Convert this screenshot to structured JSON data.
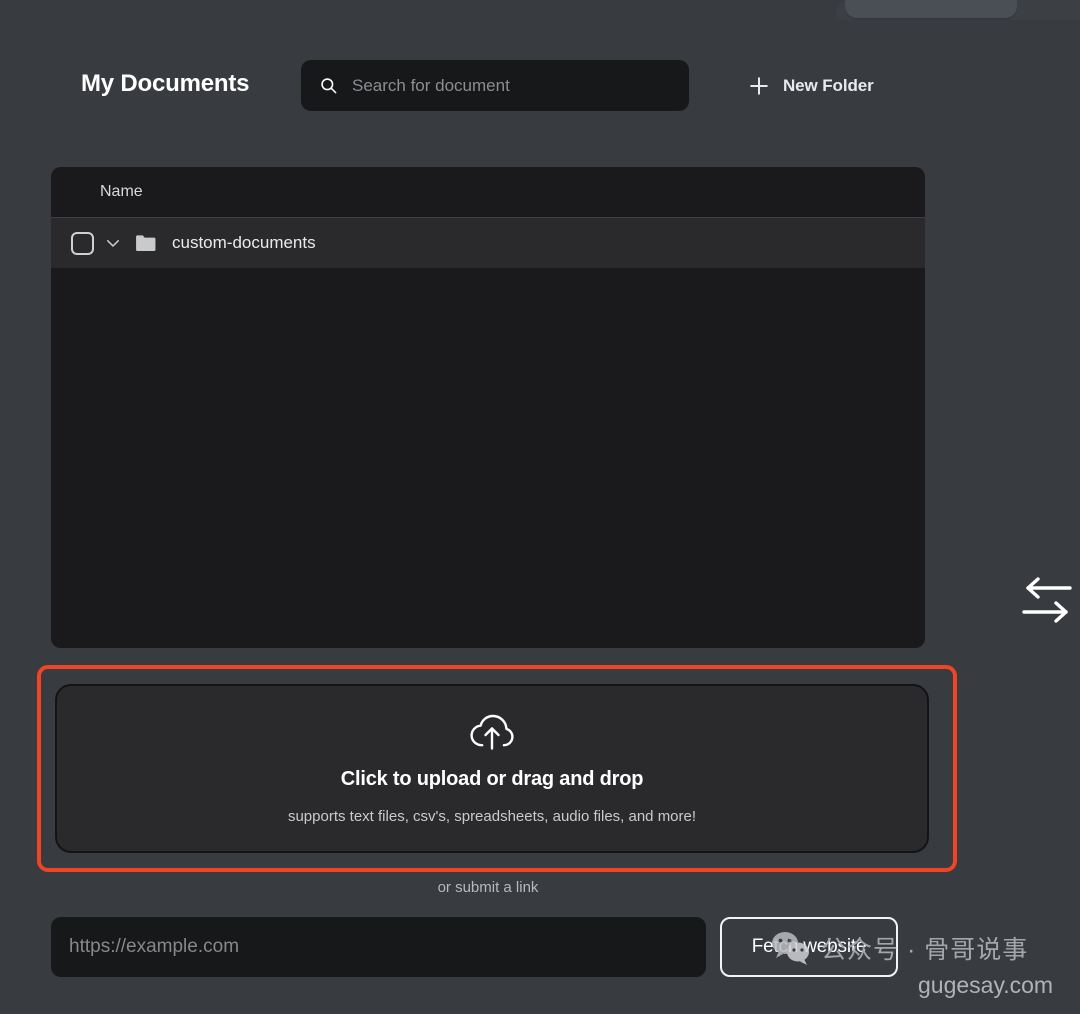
{
  "header": {
    "title": "My Documents",
    "search": {
      "placeholder": "Search for document",
      "value": "",
      "icon": "search-icon"
    },
    "new_folder": {
      "label": "New Folder",
      "icon": "plus-icon"
    }
  },
  "file_list": {
    "columns": [
      "Name"
    ],
    "rows": [
      {
        "name": "custom-documents",
        "type": "folder",
        "checked": false,
        "expanded": false,
        "checkbox_icon": "checkbox-icon",
        "chevron_icon": "chevron-down-icon",
        "folder_icon": "folder-icon"
      }
    ]
  },
  "transfer": {
    "icon": "transfer-arrows-icon"
  },
  "upload": {
    "icon": "cloud-upload-icon",
    "title": "Click to upload or drag and drop",
    "subtitle": "supports text files, csv's, spreadsheets, audio files, and more!",
    "highlight_color": "#ef4526"
  },
  "submit_link": {
    "label": "or submit a link",
    "url_placeholder": "https://example.com",
    "url_value": "",
    "fetch_label": "Fetch website"
  },
  "watermark": {
    "text": "公众号 · 骨哥说事",
    "url": "gugesay.com",
    "logo_icon": "wechat-icon"
  },
  "colors": {
    "page_background": "#383b40",
    "panel_background": "#1a1a1c",
    "row_background": "#2a2a2c",
    "accent_red": "#ef4526"
  }
}
